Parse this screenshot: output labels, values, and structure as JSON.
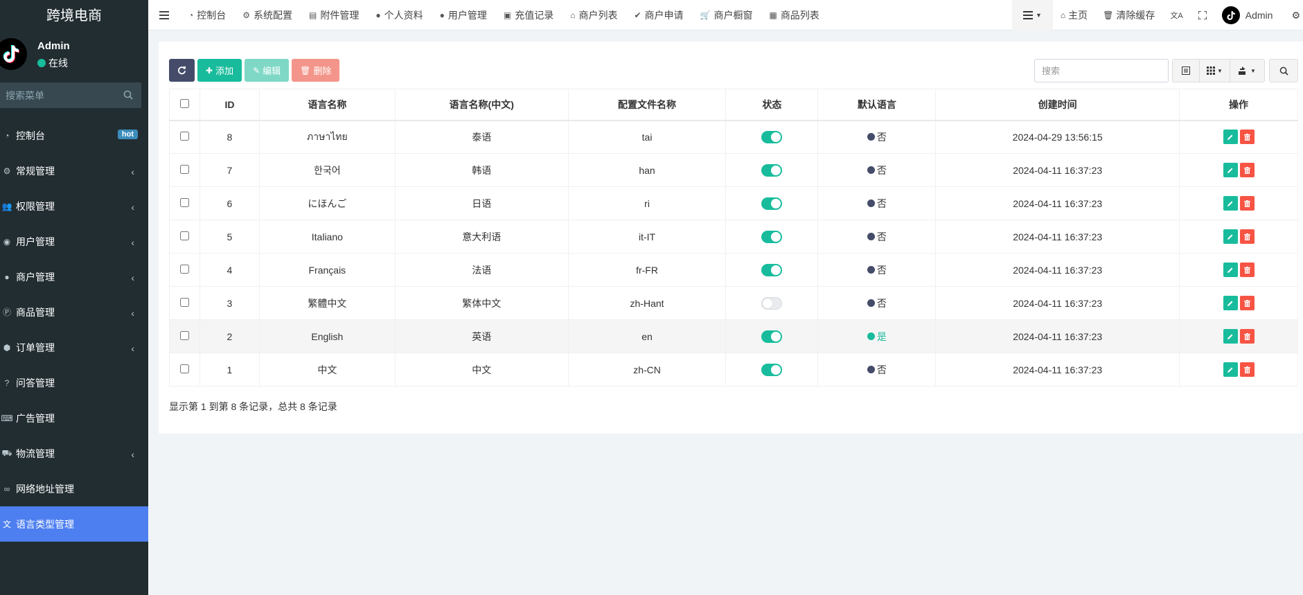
{
  "sidebar": {
    "brand": "跨境电商",
    "user": {
      "name": "Admin",
      "status": "在线"
    },
    "search_placeholder": "搜索菜单",
    "items": [
      {
        "label": "控制台",
        "icon": "dashboard-icon",
        "badge": "hot",
        "has_children": false,
        "active": false
      },
      {
        "label": "常规管理",
        "icon": "cogs-icon",
        "has_children": true,
        "active": false
      },
      {
        "label": "权限管理",
        "icon": "group-icon",
        "has_children": true,
        "active": false
      },
      {
        "label": "用户管理",
        "icon": "user-circle-icon",
        "has_children": true,
        "active": false
      },
      {
        "label": "商户管理",
        "icon": "apple-icon",
        "has_children": true,
        "active": false
      },
      {
        "label": "商品管理",
        "icon": "product-hunt-icon",
        "has_children": true,
        "active": false
      },
      {
        "label": "订单管理",
        "icon": "cube-icon",
        "has_children": true,
        "active": false
      },
      {
        "label": "问答管理",
        "icon": "question-circle-icon",
        "has_children": false,
        "active": false
      },
      {
        "label": "广告管理",
        "icon": "keyboard-icon",
        "has_children": false,
        "active": false
      },
      {
        "label": "物流管理",
        "icon": "truck-icon",
        "has_children": true,
        "active": false
      },
      {
        "label": "网络地址管理",
        "icon": "link-icon",
        "has_children": false,
        "active": false
      },
      {
        "label": "语言类型管理",
        "icon": "language-icon",
        "has_children": false,
        "active": true
      }
    ]
  },
  "navbar": {
    "tabs": [
      {
        "label": "控制台",
        "icon": "dashboard-icon"
      },
      {
        "label": "系统配置",
        "icon": "cog-icon"
      },
      {
        "label": "附件管理",
        "icon": "file-icon"
      },
      {
        "label": "个人资料",
        "icon": "user-icon"
      },
      {
        "label": "用户管理",
        "icon": "user-icon"
      },
      {
        "label": "充值记录",
        "icon": "money-icon"
      },
      {
        "label": "商户列表",
        "icon": "home-icon"
      },
      {
        "label": "商户申请",
        "icon": "check-circle-icon"
      },
      {
        "label": "商户橱窗",
        "icon": "shopping-cart-icon"
      },
      {
        "label": "商品列表",
        "icon": "shopping-bag-icon"
      }
    ],
    "right": {
      "home_label": "主页",
      "clear_cache_label": "清除缓存",
      "admin_label": "Admin"
    }
  },
  "toolbar": {
    "add_label": "添加",
    "edit_label": "编辑",
    "delete_label": "删除",
    "search_placeholder": "搜索"
  },
  "table": {
    "headers": [
      "ID",
      "语言名称",
      "语言名称(中文)",
      "配置文件名称",
      "状态",
      "默认语言",
      "创建时间",
      "操作"
    ],
    "rows": [
      {
        "id": "8",
        "name": "ภาษาไทย",
        "name_cn": "泰语",
        "config": "tai",
        "status_on": true,
        "default": "否",
        "created": "2024-04-29 13:56:15"
      },
      {
        "id": "7",
        "name": "한국어",
        "name_cn": "韩语",
        "config": "han",
        "status_on": true,
        "default": "否",
        "created": "2024-04-11 16:37:23"
      },
      {
        "id": "6",
        "name": "にほんご",
        "name_cn": "日语",
        "config": "ri",
        "status_on": true,
        "default": "否",
        "created": "2024-04-11 16:37:23"
      },
      {
        "id": "5",
        "name": "Italiano",
        "name_cn": "意大利语",
        "config": "it-IT",
        "status_on": true,
        "default": "否",
        "created": "2024-04-11 16:37:23"
      },
      {
        "id": "4",
        "name": "Français",
        "name_cn": "法语",
        "config": "fr-FR",
        "status_on": true,
        "default": "否",
        "created": "2024-04-11 16:37:23"
      },
      {
        "id": "3",
        "name": "繁體中文",
        "name_cn": "繁体中文",
        "config": "zh-Hant",
        "status_on": false,
        "default": "否",
        "created": "2024-04-11 16:37:23"
      },
      {
        "id": "2",
        "name": "English",
        "name_cn": "英语",
        "config": "en",
        "status_on": true,
        "default": "是",
        "created": "2024-04-11 16:37:23"
      },
      {
        "id": "1",
        "name": "中文",
        "name_cn": "中文",
        "config": "zh-CN",
        "status_on": true,
        "default": "否",
        "created": "2024-04-11 16:37:23"
      }
    ]
  },
  "footer": {
    "info": "显示第 1 到第 8 条记录，总共 8 条记录"
  },
  "colors": {
    "sidebar_bg": "#222d32",
    "active_menu": "#4d7ff0",
    "success": "#18bc9c",
    "danger": "#f75444",
    "primary_dark": "#444c69"
  }
}
